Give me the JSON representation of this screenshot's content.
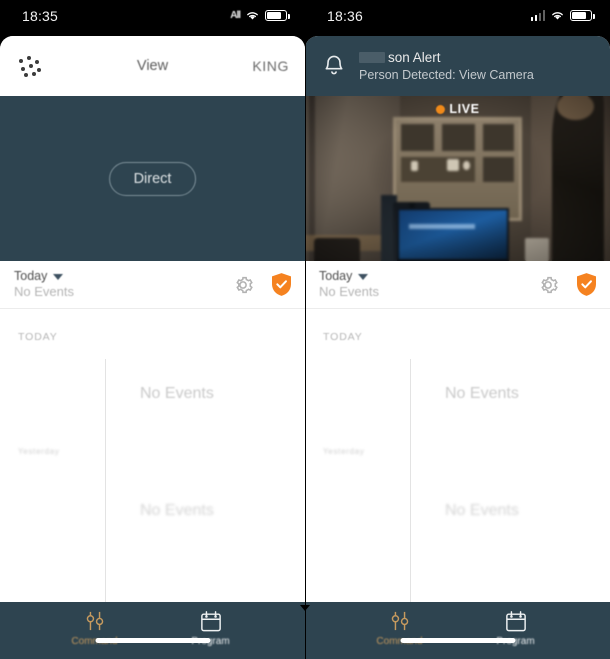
{
  "left_phone": {
    "status_bar": {
      "time": "18:35",
      "signal_label": "All",
      "wifi": "wifi-icon",
      "battery": "battery-icon"
    },
    "header": {
      "menu_icon": "grid-dots-icon",
      "title": "View",
      "right_label": "KING"
    },
    "hero": {
      "button_label": "Direct"
    },
    "toolbar": {
      "day": "Today",
      "subtitle": "No Events",
      "gear_icon": "gear-icon",
      "shield_icon": "shield-check-icon"
    },
    "timeline": {
      "today_label": "TODAY",
      "no_events": "No Events",
      "yesterday_label": "Yesterday",
      "no_events_2": "No Events"
    },
    "tabbar": {
      "items": [
        {
          "label": "Command",
          "icon": "sliders-icon",
          "active": true
        },
        {
          "label": "Program",
          "icon": "calendar-icon",
          "active": false
        }
      ]
    }
  },
  "right_phone": {
    "status_bar": {
      "time": "18:36",
      "signal_label": "bars",
      "wifi": "wifi-icon",
      "battery": "battery-icon"
    },
    "banner": {
      "icon": "bell-icon",
      "title": "son Alert",
      "subtitle": "Person Detected: View Camera"
    },
    "camera": {
      "live_label": "LIVE",
      "live_dot": "live-dot-icon"
    },
    "toolbar": {
      "day": "Today",
      "subtitle": "No Events",
      "gear_icon": "gear-icon",
      "shield_icon": "shield-check-icon"
    },
    "timeline": {
      "today_label": "TODAY",
      "no_events": "No Events",
      "yesterday_label": "Yesterday",
      "no_events_2": "No Events"
    },
    "tabbar": {
      "items": [
        {
          "label": "Command",
          "icon": "sliders-icon",
          "active": true
        },
        {
          "label": "Program",
          "icon": "calendar-icon",
          "active": false
        }
      ]
    }
  },
  "colors": {
    "panel": "#2e4450",
    "accent_orange": "#f58220",
    "tab_active": "#c69a5e",
    "card_bg": "#ffffff",
    "muted_text": "#b4b4b4"
  }
}
